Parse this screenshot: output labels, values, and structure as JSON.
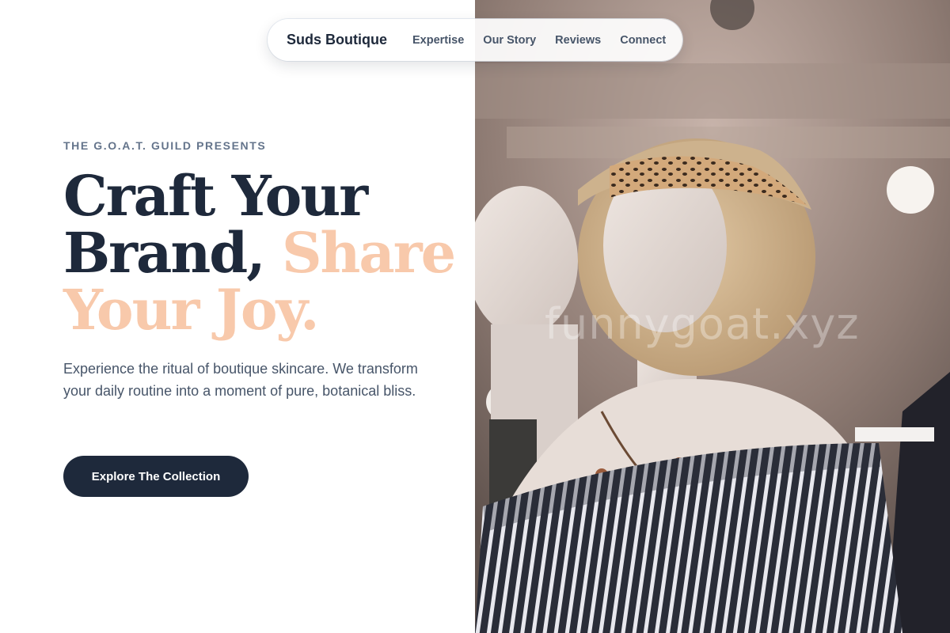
{
  "nav": {
    "brand": "Suds Boutique",
    "links": [
      "Expertise",
      "Our Story",
      "Reviews",
      "Connect"
    ]
  },
  "hero": {
    "eyebrow": "THE G.O.A.T. GUILD PRESENTS",
    "headline_main": "Craft Your Brand, ",
    "headline_accent": "Share Your Joy.",
    "lead": "Experience the ritual of boutique skincare. We transform your daily routine into a moment of pure, botanical bliss.",
    "cta_label": "Explore The Collection"
  },
  "image": {
    "watermark": "funnygoat.xyz"
  },
  "colors": {
    "primary": "#1e293b",
    "accent": "#f8c9ab",
    "muted": "#64748b"
  }
}
